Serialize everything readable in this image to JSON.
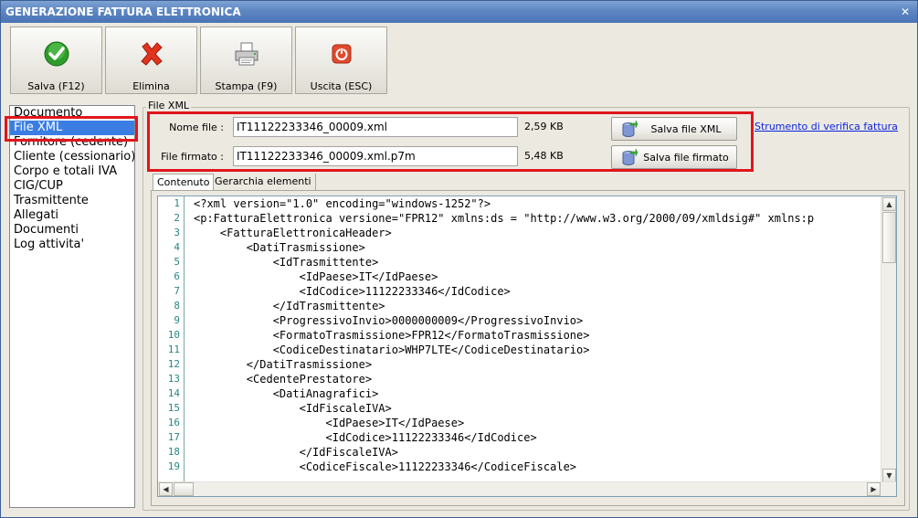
{
  "window": {
    "title": "GENERAZIONE FATTURA ELETTRONICA",
    "close_glyph": "✕"
  },
  "toolbar": {
    "save_label": "Salva (F12)",
    "delete_label": "Elimina",
    "print_label": "Stampa (F9)",
    "exit_label": "Uscita (ESC)",
    "icons": [
      "check-icon",
      "delete-x-icon",
      "printer-icon",
      "power-icon"
    ]
  },
  "sidebar": {
    "items": [
      {
        "label": "Documento"
      },
      {
        "label": "File XML",
        "selected": true
      },
      {
        "label": "Fornitore (cedente)"
      },
      {
        "label": "Cliente (cessionario)"
      },
      {
        "label": "Corpo e totali IVA"
      },
      {
        "label": "CIG/CUP"
      },
      {
        "label": "Trasmittente"
      },
      {
        "label": "Allegati"
      },
      {
        "label": "Documenti"
      },
      {
        "label": "Log attivita'"
      }
    ]
  },
  "file_xml": {
    "group_title": "File XML",
    "nome_file_label": "Nome file :",
    "nome_file_value": "IT11122233346_00009.xml",
    "nome_file_size": "2,59 KB",
    "file_firmato_label": "File firmato :",
    "file_firmato_value": "IT11122233346_00009.xml.p7m",
    "file_firmato_size": "5,48 KB",
    "save_xml_label": "Salva file XML",
    "save_signed_label": "Salva file firmato",
    "verify_link": "Strumento di verifica fattura"
  },
  "tabs": [
    {
      "label": "Contenuto",
      "active": true
    },
    {
      "label": "Gerarchia elementi",
      "active": false
    }
  ],
  "editor": {
    "line_numbers": [
      "1",
      "2",
      "3",
      "4",
      "5",
      "6",
      "7",
      "8",
      "9",
      "10",
      "11",
      "12",
      "13",
      "14",
      "15",
      "16",
      "17",
      "18",
      "19"
    ],
    "lines": [
      "<?xml version=\"1.0\" encoding=\"windows-1252\"?>",
      "<p:FatturaElettronica versione=\"FPR12\" xmlns:ds = \"http://www.w3.org/2000/09/xmldsig#\" xmlns:p",
      "    <FatturaElettronicaHeader>",
      "        <DatiTrasmissione>",
      "            <IdTrasmittente>",
      "                <IdPaese>IT</IdPaese>",
      "                <IdCodice>11122233346</IdCodice>",
      "            </IdTrasmittente>",
      "            <ProgressivoInvio>0000000009</ProgressivoInvio>",
      "            <FormatoTrasmissione>FPR12</FormatoTrasmissione>",
      "            <CodiceDestinatario>WHP7LTE</CodiceDestinatario>",
      "        </DatiTrasmissione>",
      "        <CedentePrestatore>",
      "            <DatiAnagrafici>",
      "                <IdFiscaleIVA>",
      "                    <IdPaese>IT</IdPaese>",
      "                    <IdCodice>11122233346</IdCodice>",
      "                </IdFiscaleIVA>",
      "                <CodiceFiscale>11122233346</CodiceFiscale>"
    ]
  },
  "colors": {
    "highlight_frame": "#e0161c",
    "selection": "#3a7ee3",
    "link": "#0a24e0"
  }
}
